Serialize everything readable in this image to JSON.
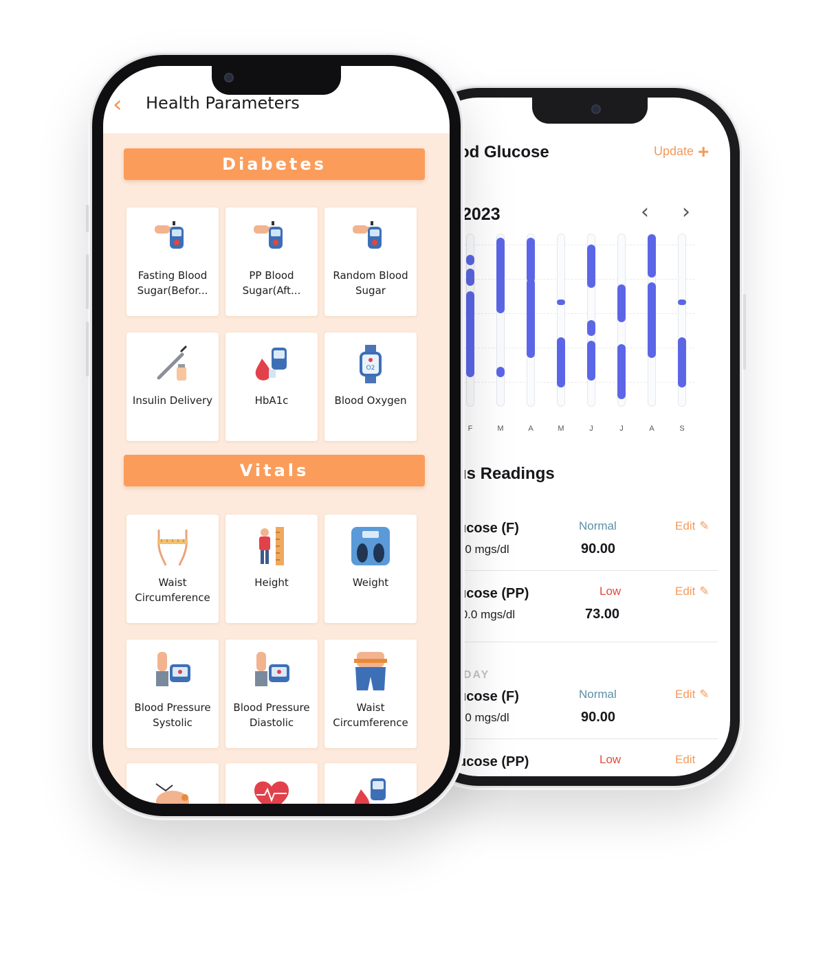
{
  "front_phone": {
    "title": "Health Parameters",
    "sections": [
      {
        "title": "Diabetes",
        "cards": [
          {
            "label_lines": [
              "Fasting Blood",
              "Sugar(Befor..."
            ],
            "icon": "glucometer-hand-icon"
          },
          {
            "label_lines": [
              "PP Blood",
              "Sugar(Aft..."
            ],
            "icon": "glucometer-hand-icon"
          },
          {
            "label_lines": [
              "Random Blood",
              "Sugar"
            ],
            "icon": "glucometer-hand-icon"
          },
          {
            "label_lines": [
              "Insulin Delivery",
              ""
            ],
            "icon": "syringe-icon"
          },
          {
            "label_lines": [
              "HbA1c",
              ""
            ],
            "icon": "blood-drop-meter-icon"
          },
          {
            "label_lines": [
              "Blood Oxygen",
              ""
            ],
            "icon": "smartwatch-icon"
          }
        ]
      },
      {
        "title": "Vitals",
        "cards": [
          {
            "label_lines": [
              "Waist",
              "Circumference"
            ],
            "icon": "waist-measure-icon"
          },
          {
            "label_lines": [
              "Height",
              ""
            ],
            "icon": "height-ruler-icon"
          },
          {
            "label_lines": [
              "Weight",
              ""
            ],
            "icon": "weighing-scale-icon"
          },
          {
            "label_lines": [
              "Blood Pressure",
              "Systolic"
            ],
            "icon": "bp-monitor-icon"
          },
          {
            "label_lines": [
              "Blood Pressure",
              "Diastolic"
            ],
            "icon": "bp-monitor-icon"
          },
          {
            "label_lines": [
              "Waist",
              "Circumference"
            ],
            "icon": "waist-jeans-icon"
          },
          {
            "label_lines": [
              "",
              ""
            ],
            "icon": "piggy-icon"
          },
          {
            "label_lines": [
              "",
              ""
            ],
            "icon": "heart-rate-icon"
          },
          {
            "label_lines": [
              "",
              ""
            ],
            "icon": "blood-drop-meter-icon"
          }
        ]
      }
    ]
  },
  "back_phone": {
    "title": "od Glucose",
    "update_label": "Update",
    "year": "2023",
    "chart_data": {
      "type": "range-bar",
      "categories": [
        "F",
        "M",
        "A",
        "M",
        "J",
        "J",
        "A",
        "S"
      ],
      "series": [
        {
          "values": [
            [
              82,
              88
            ],
            [
              70,
              80
            ],
            [
              17,
              67
            ]
          ]
        },
        {
          "values": [
            [
              54,
              98
            ],
            [
              17,
              23
            ]
          ]
        },
        {
          "values": [
            [
              72,
              98
            ],
            [
              28,
              74
            ]
          ]
        },
        {
          "values": [
            [
              59,
              62
            ],
            [
              11,
              40
            ]
          ]
        },
        {
          "values": [
            [
              69,
              94
            ],
            [
              41,
              50
            ],
            [
              15,
              38
            ]
          ]
        },
        {
          "values": [
            [
              49,
              71
            ],
            [
              4,
              36
            ]
          ]
        },
        {
          "values": [
            [
              75,
              100
            ],
            [
              28,
              72
            ]
          ]
        },
        {
          "values": [
            [
              59,
              62
            ],
            [
              11,
              40
            ]
          ]
        }
      ]
    },
    "readings_title": "us Readings",
    "day_label": "DAY",
    "readings": [
      {
        "name": "ucose (F)",
        "range": ").0 mgs/dl",
        "status": "Normal",
        "status_color": "#5b8fa6",
        "value": "90.00",
        "edit": "Edit"
      },
      {
        "name": "ucose (PP)",
        "range": ";0.0 mgs/dl",
        "status": "Low",
        "status_color": "#e24a3b",
        "value": "73.00",
        "edit": "Edit"
      },
      {
        "name": "ucose (F)",
        "range": ").0 mgs/dl",
        "status": "Normal",
        "status_color": "#5b8fa6",
        "value": "90.00",
        "edit": "Edit"
      },
      {
        "name": "ucose (PP)",
        "range": "",
        "status": "Low",
        "status_color": "#e24a3b",
        "value": "",
        "edit": "Edit"
      }
    ]
  },
  "colors": {
    "accent": "#fb9c5b",
    "bar": "#5b66e6",
    "screen_bg": "#fdeadc"
  }
}
